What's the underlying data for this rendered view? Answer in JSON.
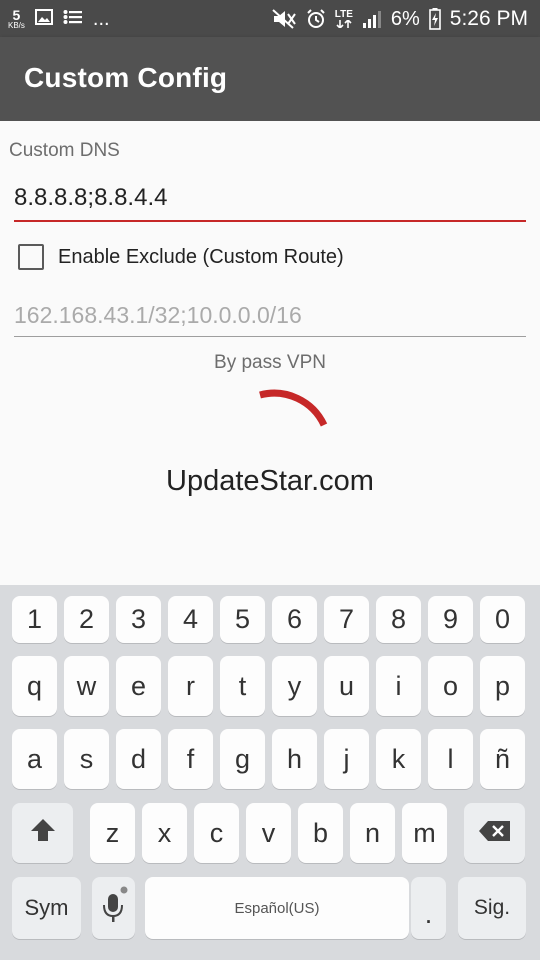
{
  "status_bar": {
    "net_speed": "5",
    "net_unit": "KB/s",
    "more": "...",
    "battery": "6%",
    "time": "5:26 PM",
    "signal_type": "LTE"
  },
  "app_bar": {
    "title": "Custom Config"
  },
  "form": {
    "dns_label": "Custom DNS",
    "dns_value": "8.8.8.8;8.8.4.4",
    "exclude_checkbox_label": "Enable Exclude (Custom Route)",
    "exclude_checked": false,
    "route_placeholder": "162.168.43.1/32;10.0.0.0/16",
    "bypass_label": "By pass VPN"
  },
  "watermark": "UpdateStar.com",
  "keyboard": {
    "row_numbers": [
      "1",
      "2",
      "3",
      "4",
      "5",
      "6",
      "7",
      "8",
      "9",
      "0"
    ],
    "row_1": [
      "q",
      "w",
      "e",
      "r",
      "t",
      "y",
      "u",
      "i",
      "o",
      "p"
    ],
    "row_2": [
      "a",
      "s",
      "d",
      "f",
      "g",
      "h",
      "j",
      "k",
      "l",
      "ñ"
    ],
    "row_3": [
      "z",
      "x",
      "c",
      "v",
      "b",
      "n",
      "m"
    ],
    "sym_label": "Sym",
    "space_label": "Español(US)",
    "period_label": ".",
    "next_label": "Sig."
  },
  "colors": {
    "accent": "#c62828",
    "app_bar": "#525252",
    "status_bar": "#4a4a4a"
  }
}
